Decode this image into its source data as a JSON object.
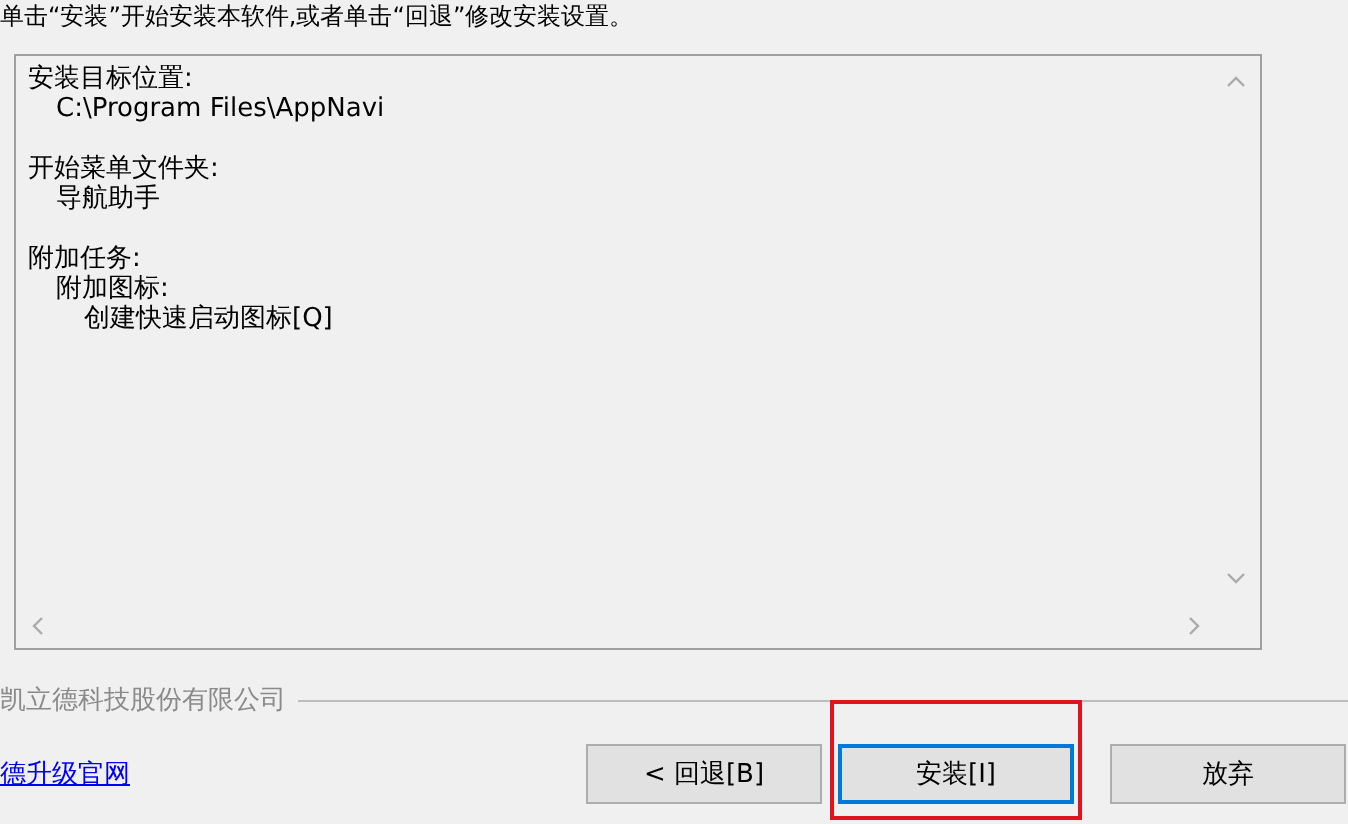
{
  "instruction": "单击“安装”开始安装本软件,或者单击“回退”修改安装设置。",
  "summary": [
    {
      "text": "安装目标位置:",
      "children": [
        {
          "text": "C:\\Program Files\\AppNavi"
        }
      ]
    },
    {
      "text": "开始菜单文件夹:",
      "children": [
        {
          "text": "导航助手"
        }
      ]
    },
    {
      "text": "附加任务:",
      "children": [
        {
          "text": "附加图标:",
          "children": [
            {
              "text": "创建快速启动图标[Q]"
            }
          ]
        }
      ]
    }
  ],
  "brand_group": "凯立德科技股份有限公司",
  "link": "德升级官网",
  "buttons": [
    {
      "label": "< 回退[B]",
      "default": false,
      "highlighted": false
    },
    {
      "label": "安装[I]",
      "default": true,
      "highlighted": true
    },
    {
      "label": "放弃",
      "default": false,
      "highlighted": false
    }
  ]
}
